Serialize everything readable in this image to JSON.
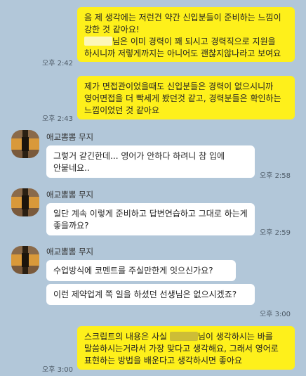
{
  "colors": {
    "background": "#b2c7d9",
    "my_bubble": "#fef01b",
    "their_bubble": "#ffffff"
  },
  "contact": {
    "name": "애교뽐뽐 무지"
  },
  "messages": [
    {
      "sender": "me",
      "line1": "음 제 생각에는 저런건 약간 신입분들이 준비하는 느낌이 강한 것 같아요!",
      "pre_redacted": "",
      "post_redacted": "님은 이미 경력이 꽤 되시고 경력직으로 지원을 하시니까 저렇게까지는 아니어도 괜찮지않나라고 보여요",
      "time": "오후 2:42"
    },
    {
      "sender": "me",
      "text": "제가 면접관이었을때도 신입분들은 경력이 없으시니까 영어면접을 더 빡세게 봤던것 같고, 경력분들은 확인하는 느낌이었던 것 같아요",
      "time": "오후 2:43"
    },
    {
      "sender": "them",
      "text": "그렇거 같긴한데... 영어가 안하다 하려니 참 입에 안붙네요..",
      "time": "오후 2:58"
    },
    {
      "sender": "them",
      "text": "일단 계속 이렇게 준비하고 답변연습하고 그대로 하는게 좋을까요?",
      "time": "오후 2:59"
    },
    {
      "sender": "them",
      "text": "수업방식에 코멘트를 주실만한게 잇으신가요?"
    },
    {
      "sender": "them",
      "text": "이런 제약업계 쪽 일을 하셨던 선생님은 없으시겠죠?",
      "time": "오후 3:00"
    },
    {
      "sender": "me",
      "pre_redacted": "스크립트의 내용은 사실 ",
      "post_redacted": "님이 생각하시는 바를 말씀하시는거라서 가장 맞다고 생각해요, 그래서 영어로 표현하는 방법을 배운다고 생각하시면 좋아요",
      "time": "오후 3:00"
    }
  ]
}
